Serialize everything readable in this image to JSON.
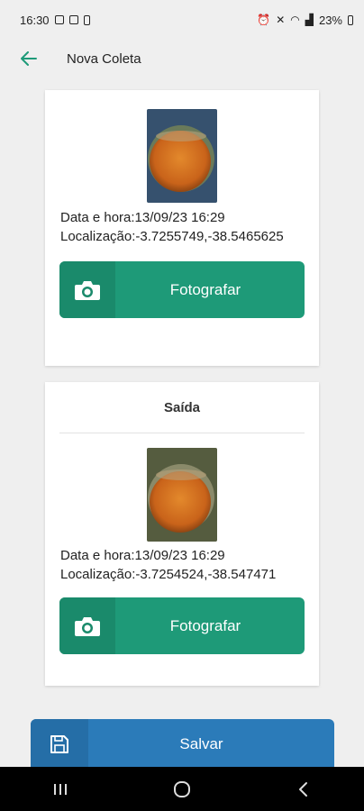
{
  "status_bar": {
    "time": "16:30",
    "battery": "23%"
  },
  "app_bar": {
    "title": "Nova Coleta"
  },
  "cards": [
    {
      "title": "",
      "datetime_text": "Data e hora:13/09/23 16:29",
      "location_text": "Localização:-3.7255749,-38.5465625",
      "button_label": "Fotografar"
    },
    {
      "title": "Saída",
      "datetime_text": "Data e hora:13/09/23 16:29",
      "location_text": "Localização:-3.7254524,-38.547471",
      "button_label": "Fotografar"
    }
  ],
  "save_button": {
    "label": "Salvar"
  },
  "colors": {
    "photo_button": "#1e9a78",
    "save_button": "#2b7bb9",
    "back_arrow": "#1e9a78"
  }
}
